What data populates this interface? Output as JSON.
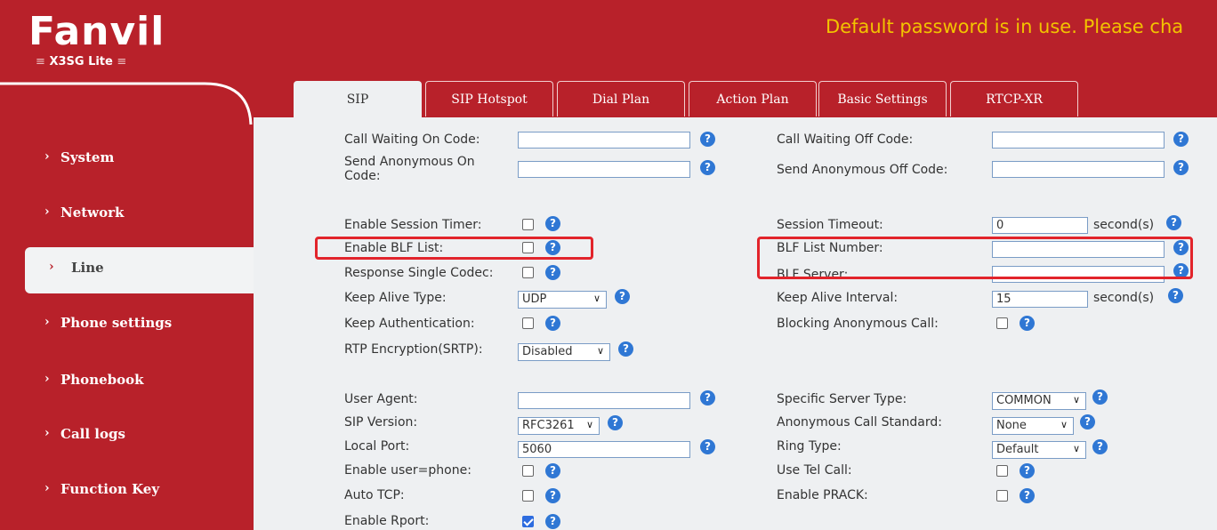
{
  "brand": {
    "logo": "Fanvil",
    "model": "X3SG Lite",
    "model_dash": "≡"
  },
  "warning": "Default password is in use. Please cha",
  "sidebar": {
    "items": [
      {
        "label": "System"
      },
      {
        "label": "Network"
      },
      {
        "label": "Line"
      },
      {
        "label": "Phone settings"
      },
      {
        "label": "Phonebook"
      },
      {
        "label": "Call logs"
      },
      {
        "label": "Function Key"
      }
    ],
    "chevron": "›"
  },
  "tabs": [
    {
      "label": "SIP"
    },
    {
      "label": "SIP Hotspot"
    },
    {
      "label": "Dial Plan"
    },
    {
      "label": "Action Plan"
    },
    {
      "label": "Basic Settings"
    },
    {
      "label": "RTCP-XR"
    }
  ],
  "form": {
    "call_waiting_on": {
      "label": "Call Waiting On Code:",
      "value": ""
    },
    "call_waiting_off": {
      "label": "Call Waiting Off Code:",
      "value": ""
    },
    "send_anon_on": {
      "label": "Send Anonymous On Code:",
      "value": ""
    },
    "send_anon_off": {
      "label": "Send Anonymous Off Code:",
      "value": ""
    },
    "enable_session_timer": {
      "label": "Enable Session Timer:",
      "checked": false
    },
    "session_timeout": {
      "label": "Session Timeout:",
      "value": "0",
      "unit": "second(s)"
    },
    "enable_blf_list": {
      "label": "Enable BLF List:",
      "checked": false
    },
    "blf_list_number": {
      "label": "BLF List Number:",
      "value": ""
    },
    "response_single_codec": {
      "label": "Response Single Codec:",
      "checked": false
    },
    "blf_server": {
      "label": "BLF Server:",
      "value": ""
    },
    "keep_alive_type": {
      "label": "Keep Alive Type:",
      "value": "UDP"
    },
    "keep_alive_interval": {
      "label": "Keep Alive Interval:",
      "value": "15",
      "unit": "second(s)"
    },
    "keep_authentication": {
      "label": "Keep Authentication:",
      "checked": false
    },
    "blocking_anonymous_call": {
      "label": "Blocking Anonymous Call:",
      "checked": false
    },
    "rtp_encryption": {
      "label": "RTP Encryption(SRTP):",
      "value": "Disabled"
    },
    "user_agent": {
      "label": "User Agent:",
      "value": ""
    },
    "specific_server_type": {
      "label": "Specific Server Type:",
      "value": "COMMON"
    },
    "sip_version": {
      "label": "SIP Version:",
      "value": "RFC3261"
    },
    "anonymous_call_standard": {
      "label": "Anonymous Call Standard:",
      "value": "None"
    },
    "local_port": {
      "label": "Local Port:",
      "value": "5060"
    },
    "ring_type": {
      "label": "Ring Type:",
      "value": "Default"
    },
    "enable_user_phone": {
      "label": "Enable user=phone:",
      "checked": false
    },
    "use_tel_call": {
      "label": "Use Tel Call:",
      "checked": false
    },
    "auto_tcp": {
      "label": "Auto TCP:",
      "checked": false
    },
    "enable_prack": {
      "label": "Enable PRACK:",
      "checked": false
    },
    "enable_rport": {
      "label": "Enable Rport:",
      "checked": true
    }
  },
  "help_glyph": "?",
  "select_arrow": "∨",
  "colors": {
    "brand_red": "#b8212a",
    "warning_yellow": "#f2c300",
    "help_blue": "#2f77d4",
    "highlight_red": "#e2242b"
  }
}
